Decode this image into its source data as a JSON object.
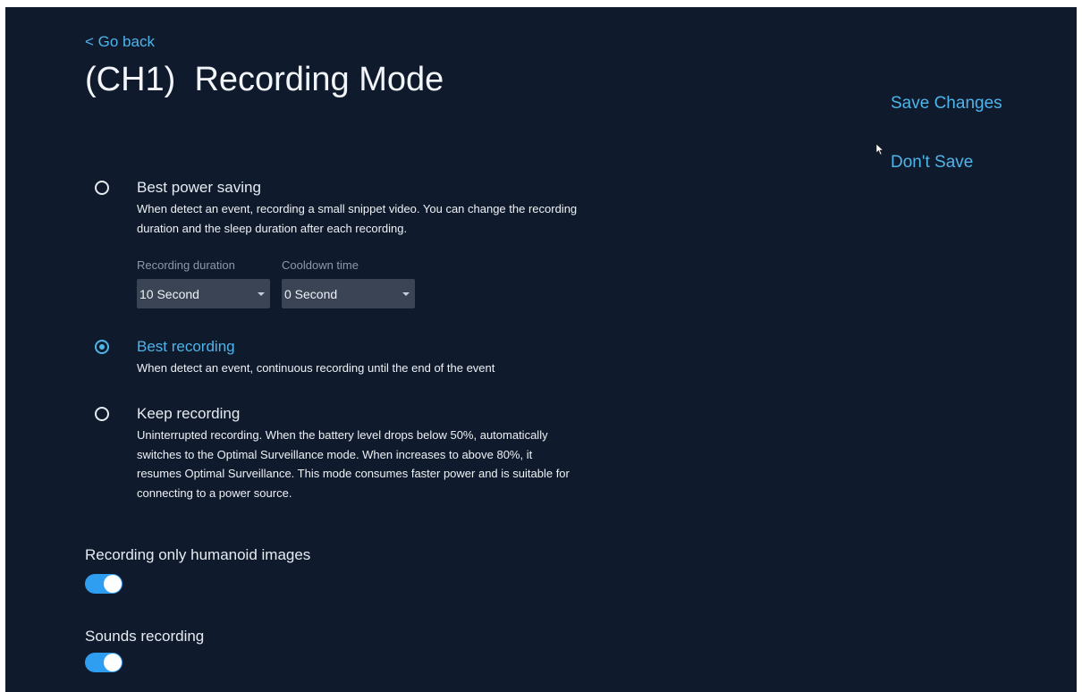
{
  "header": {
    "back_label": "< Go back",
    "title": "(CH1)  Recording Mode"
  },
  "actions": {
    "save_label": "Save Changes",
    "dont_save_label": "Don't Save"
  },
  "options": [
    {
      "title": "Best power saving",
      "description": "When detect an event, recording a small snippet video. You can change the recording duration and the sleep duration after each recording.",
      "selected": false
    },
    {
      "title": "Best recording",
      "description": "When detect an event, continuous recording until the end of the event",
      "selected": true
    },
    {
      "title": "Keep recording",
      "description": "Uninterrupted recording. When the battery level drops below 50%, automatically switches to the Optimal Surveillance mode. When increases to above 80%, it resumes Optimal Surveillance. This mode consumes faster power and is suitable for connecting to a power source.",
      "selected": false
    }
  ],
  "power_saving_settings": {
    "recording_duration": {
      "label": "Recording duration",
      "value": "10 Second"
    },
    "cooldown_time": {
      "label": "Cooldown time",
      "value": "0 Second"
    }
  },
  "toggles": [
    {
      "label": "Recording only humanoid images",
      "on": true
    },
    {
      "label": "Sounds recording",
      "on": true
    }
  ],
  "colors": {
    "background": "#0f1b2d",
    "accent": "#4fb4ea",
    "toggle_on": "#2f9df0",
    "dropdown_bg": "#3a4455"
  },
  "icons": {
    "cursor": "mouse-pointer-icon",
    "dropdown": "caret-down-icon"
  }
}
